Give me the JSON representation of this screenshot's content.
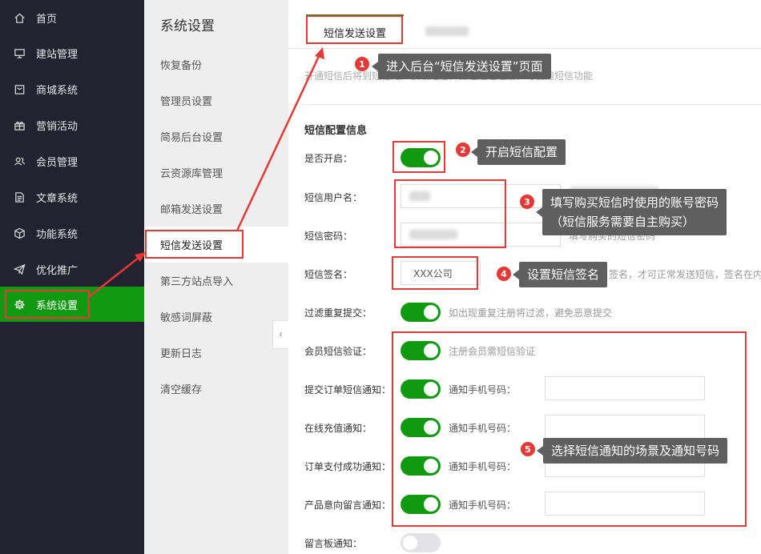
{
  "sidebar": {
    "items": [
      {
        "label": "首页",
        "icon": "home-icon"
      },
      {
        "label": "建站管理",
        "icon": "monitor-icon"
      },
      {
        "label": "商城系统",
        "icon": "shop-icon"
      },
      {
        "label": "营销活动",
        "icon": "gift-icon"
      },
      {
        "label": "会员管理",
        "icon": "users-icon"
      },
      {
        "label": "文章系统",
        "icon": "document-icon"
      },
      {
        "label": "功能系统",
        "icon": "cube-icon"
      },
      {
        "label": "优化推广",
        "icon": "paper-plane-icon"
      },
      {
        "label": "系统设置",
        "icon": "gear-icon",
        "active": true
      }
    ]
  },
  "submenu": {
    "title": "系统设置",
    "items": [
      "恢复备份",
      "管理员设置",
      "简易后台设置",
      "云资源库管理",
      "邮箱发送设置",
      "短信发送设置",
      "第三方站点导入",
      "敏感词屏蔽",
      "更新日志",
      "清空缓存"
    ],
    "active_index": 5,
    "collapse_glyph": "‹"
  },
  "main": {
    "tabs": [
      {
        "label": "短信发送设置"
      }
    ],
    "description": "开通短信后将到短信用户获取短信，验证通过之后，可使用短信功能",
    "section_title": "短信配置信息",
    "rows": {
      "enabled": {
        "label": "是否开启："
      },
      "username": {
        "label": "短信用户名："
      },
      "password": {
        "label": "短信密码：",
        "hint": "填写购买的短信密码"
      },
      "signature": {
        "label": "短信签名：",
        "value": "XXX公司",
        "hint": "签名，才可正常发送短信，签名在内"
      },
      "filter": {
        "label": "过滤重复提交：",
        "hint": "如出现重复注册将过滤，避免恶意提交"
      },
      "member_verify": {
        "label": "会员短信验证：",
        "hint": "注册会员需短信验证"
      },
      "order_notify": {
        "label": "提交订单短信通知：",
        "phone_label": "通知手机号码："
      },
      "recharge_notify": {
        "label": "在线充值通知：",
        "phone_label": "通知手机号码："
      },
      "pay_notify": {
        "label": "订单支付成功通知：",
        "phone_label": "通知手机号码："
      },
      "intent_notify": {
        "label": "产品意向留言通知：",
        "phone_label": "通知手机号码："
      },
      "board_notify": {
        "label": "留言板通知："
      }
    }
  },
  "annotations": [
    {
      "num": "1",
      "text": "进入后台“短信发送设置”页面"
    },
    {
      "num": "2",
      "text": "开启短信配置"
    },
    {
      "num": "3",
      "text": "填写购买短信时使用的账号密码",
      "text2": "（短信服务需要自主购买）"
    },
    {
      "num": "4",
      "text": "设置短信签名"
    },
    {
      "num": "5",
      "text": "选择短信通知的场景及通知号码"
    }
  ],
  "colors": {
    "accent": "#119a11",
    "sidebar_bg": "#222230",
    "annotation_red": "#e53935",
    "callout_bg": "#5f5f5f"
  }
}
